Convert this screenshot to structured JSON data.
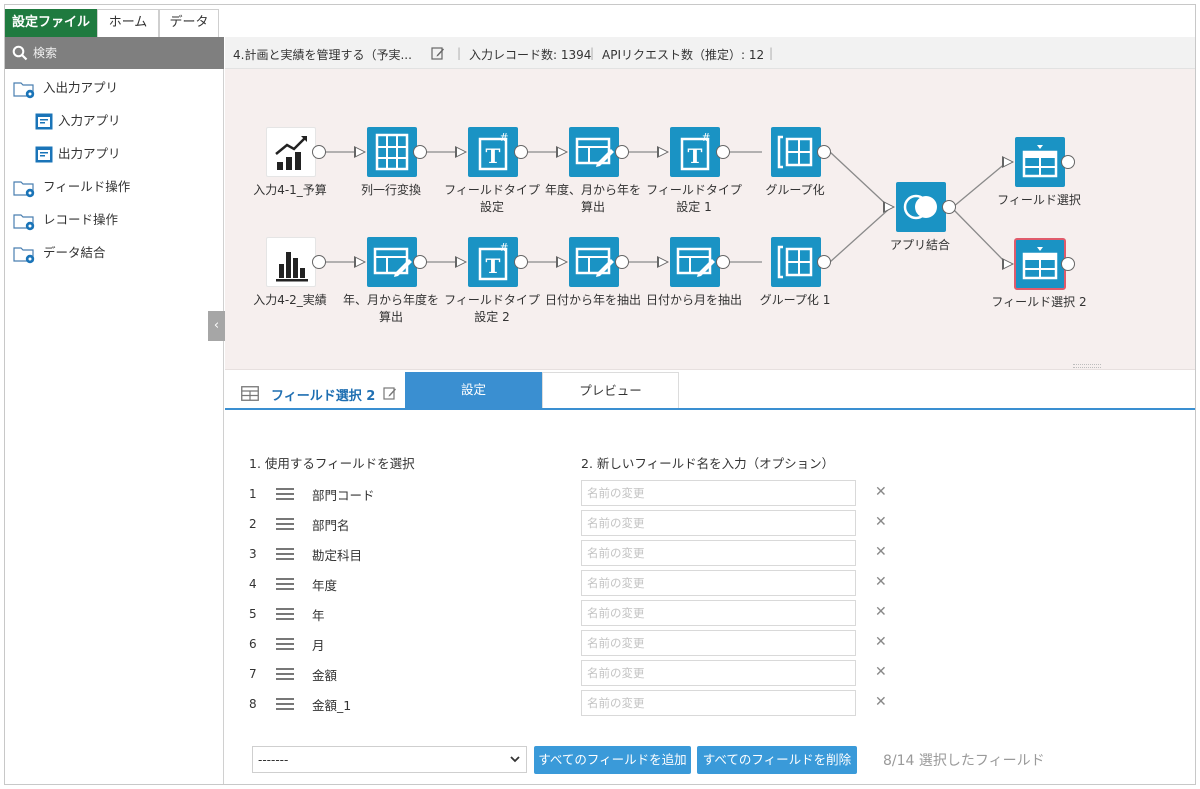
{
  "menu": {
    "tabs": [
      "設定ファイル",
      "ホーム",
      "データ"
    ],
    "active_tab": "設定ファイル"
  },
  "sidebar": {
    "search_placeholder": "検索",
    "items": [
      {
        "label": "入出力アプリ",
        "icon": "folder-gear-icon"
      },
      {
        "label": "入力アプリ",
        "icon": "app-window-icon"
      },
      {
        "label": "出力アプリ",
        "icon": "app-window-icon"
      },
      {
        "label": "フィールド操作",
        "icon": "folder-gear-icon"
      },
      {
        "label": "レコード操作",
        "icon": "folder-gear-icon"
      },
      {
        "label": "データ結合",
        "icon": "folder-gear-icon"
      }
    ],
    "collapse_glyph": "‹"
  },
  "info": {
    "flow_name": "4.計画と実績を管理する（予実...",
    "input_records": "入力レコード数: 1394",
    "api_requests": "APIリクエスト数（推定）: 12"
  },
  "flow": {
    "nodes": [
      {
        "id": "n1",
        "label": "入力4-1_予算",
        "icon": "chart-up-icon"
      },
      {
        "id": "n2",
        "label": "列一行変換",
        "icon": "pivot-icon"
      },
      {
        "id": "n3",
        "label": "フィールドタイプ設定",
        "icon": "field-type-icon"
      },
      {
        "id": "n4",
        "label": "年度、月から年を算出",
        "icon": "calc-edit-icon"
      },
      {
        "id": "n5",
        "label": "フィールドタイプ設定 1",
        "icon": "field-type-icon"
      },
      {
        "id": "n6",
        "label": "グループ化",
        "icon": "group-icon"
      },
      {
        "id": "n7",
        "label": "入力4-2_実績",
        "icon": "bar-chart-icon"
      },
      {
        "id": "n8",
        "label": "年、月から年度を算出",
        "icon": "calc-edit-icon"
      },
      {
        "id": "n9",
        "label": "フィールドタイプ設定 2",
        "icon": "field-type-icon"
      },
      {
        "id": "n10",
        "label": "日付から年を抽出",
        "icon": "calc-edit-icon"
      },
      {
        "id": "n11",
        "label": "日付から月を抽出",
        "icon": "calc-edit-icon"
      },
      {
        "id": "n12",
        "label": "グループ化 1",
        "icon": "group-icon"
      },
      {
        "id": "n13",
        "label": "アプリ結合",
        "icon": "join-icon"
      },
      {
        "id": "n14",
        "label": "フィールド選択",
        "icon": "table-select-icon"
      },
      {
        "id": "n15",
        "label": "フィールド選択 2",
        "icon": "table-select-icon"
      }
    ],
    "selected": "n15",
    "accent": "#1a93c4"
  },
  "panel": {
    "title": "フィールド選択 2",
    "tabs": [
      "設定",
      "プレビュー"
    ],
    "active_tab": "設定",
    "col1_header": "1. 使用するフィールドを選択",
    "col2_header": "2. 新しいフィールド名を入力（オプション）",
    "rename_placeholder": "名前の変更",
    "fields": [
      {
        "num": "1",
        "name": "部門コード"
      },
      {
        "num": "2",
        "name": "部門名"
      },
      {
        "num": "3",
        "name": "勘定科目"
      },
      {
        "num": "4",
        "name": "年度"
      },
      {
        "num": "5",
        "name": "年"
      },
      {
        "num": "6",
        "name": "月"
      },
      {
        "num": "7",
        "name": "金額"
      },
      {
        "num": "8",
        "name": "金額_1"
      }
    ],
    "remove_glyph": "✕",
    "select_value": "-------",
    "add_all_label": "すべてのフィールドを追加",
    "remove_all_label": "すべてのフィールドを削除",
    "selected_count": "8/14 選択したフィールド"
  }
}
